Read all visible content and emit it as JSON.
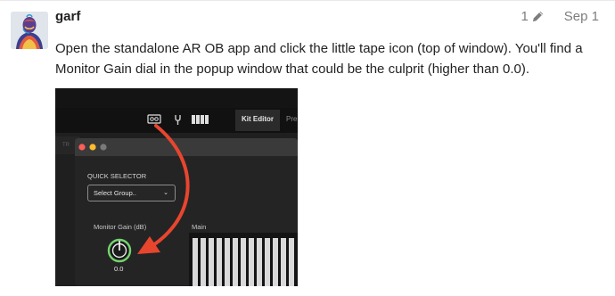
{
  "post": {
    "author": "garf",
    "edit_count": "1",
    "date": "Sep 1",
    "body": "Open the standalone AR OB app and click the little tape icon (top of window). You'll find a Monitor Gain dial in the popup window that could be the culprit (higher than 0.0)."
  },
  "icons": {
    "edit": "pencil-icon",
    "tape": "tape-icon",
    "tuning_fork": "tuning-fork-icon",
    "keyboard": "piano-keys-icon",
    "dropdown": "chevron-down-icon"
  },
  "screenshot": {
    "tabs": {
      "kit_editor": "Kit Editor",
      "next_tab": "Pre"
    },
    "left_stub": "TR",
    "quick_selector_label": "QUICK SELECTOR",
    "select_value": "Select Group..",
    "monitor_gain_label": "Monitor Gain (dB)",
    "main_label": "Main",
    "monitor_gain_value": "0.0"
  },
  "colors": {
    "text": "#222222",
    "muted": "#7d7d7d",
    "arrow": "#e8452f",
    "knob": "#74d46f",
    "traffic_red": "#ff5f57",
    "traffic_yellow": "#febc2e",
    "traffic_gray": "#7a7a7a"
  }
}
